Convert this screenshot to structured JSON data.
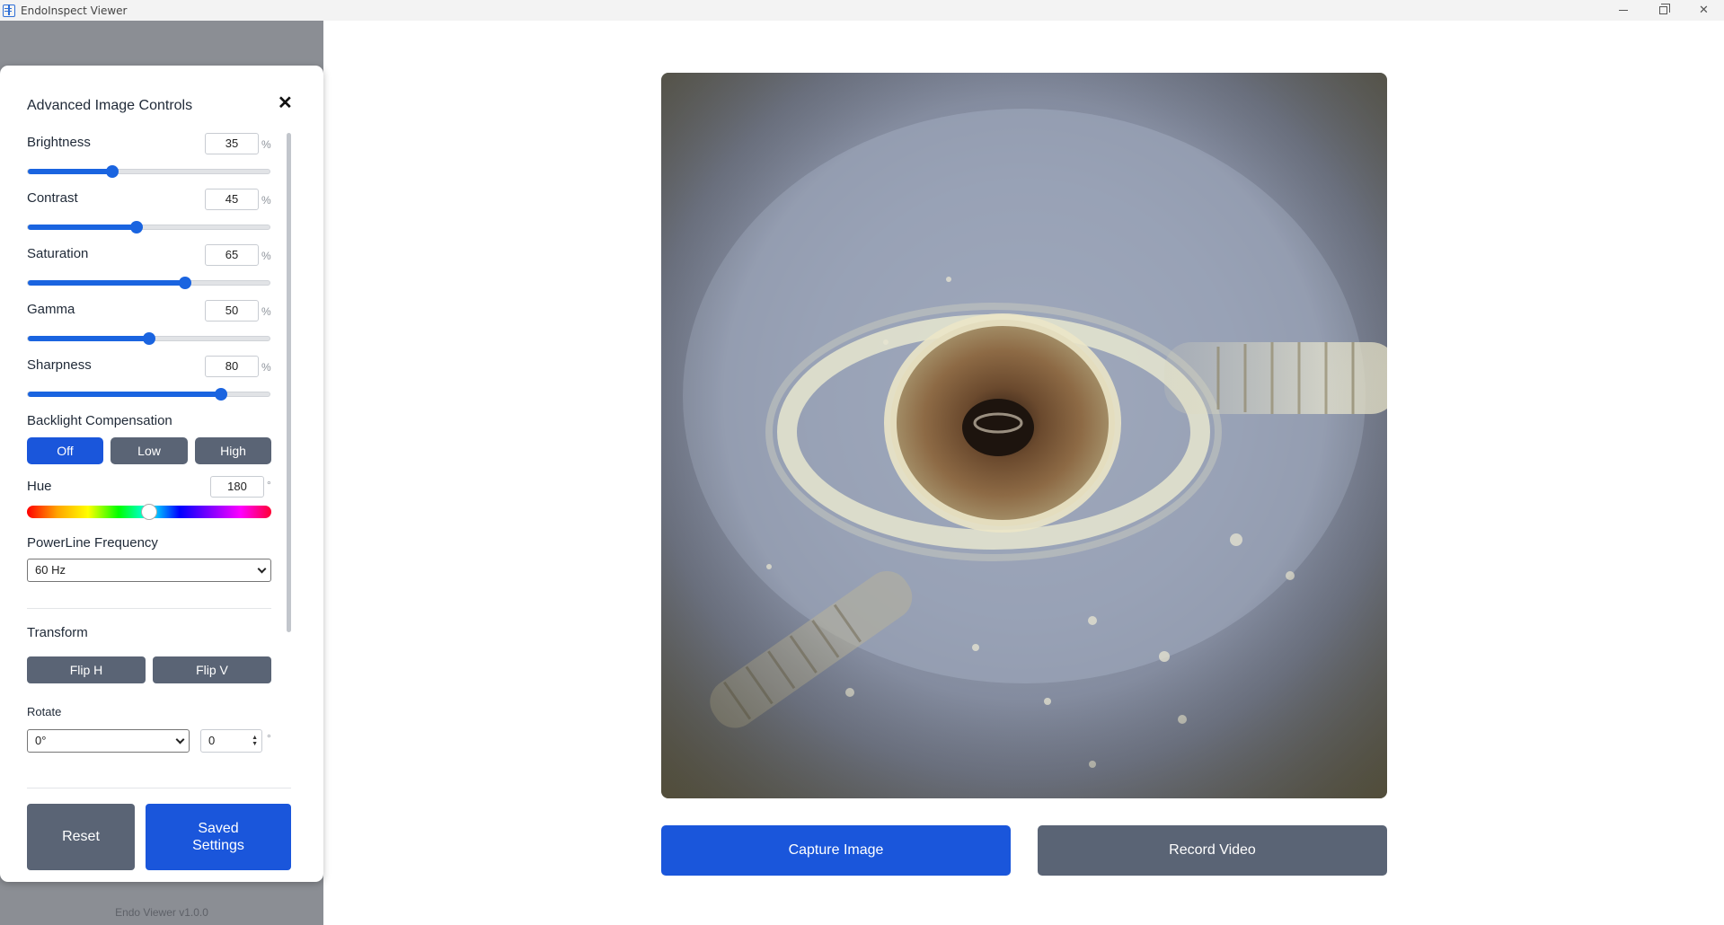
{
  "window": {
    "title": "EndoInspect Viewer",
    "minimize": "—",
    "restore": "❐",
    "close": "✕"
  },
  "panel": {
    "title": "Advanced Image Controls",
    "close_glyph": "✕",
    "sliders": [
      {
        "label": "Brightness",
        "value": "35",
        "unit": "%",
        "level": 35
      },
      {
        "label": "Contrast",
        "value": "45",
        "unit": "%",
        "level": 45
      },
      {
        "label": "Saturation",
        "value": "65",
        "unit": "%",
        "level": 65
      },
      {
        "label": "Gamma",
        "value": "50",
        "unit": "%",
        "level": 50
      },
      {
        "label": "Sharpness",
        "value": "80",
        "unit": "%",
        "level": 80
      }
    ],
    "backlight": {
      "label": "Backlight Compensation",
      "options": [
        "Off",
        "Low",
        "High"
      ],
      "selected": "Off"
    },
    "hue": {
      "label": "Hue",
      "value": "180",
      "unit": "°",
      "level": 180,
      "max": 360
    },
    "powerline": {
      "label": "PowerLine Frequency",
      "selected": "60 Hz"
    },
    "transform": {
      "label": "Transform",
      "flip_h": "Flip H",
      "flip_v": "Flip V"
    },
    "rotate": {
      "label": "Rotate",
      "selected": "0°",
      "value": "0",
      "unit": "°"
    },
    "reset": "Reset",
    "saved_line1": "Saved",
    "saved_line2": "Settings"
  },
  "footer": {
    "version": "Endo Viewer v1.0.0"
  },
  "actions": {
    "capture": "Capture Image",
    "record": "Record Video"
  },
  "colors": {
    "primary": "#1a56db",
    "secondary": "#5a6475",
    "sidebar": "#8b8e94"
  }
}
